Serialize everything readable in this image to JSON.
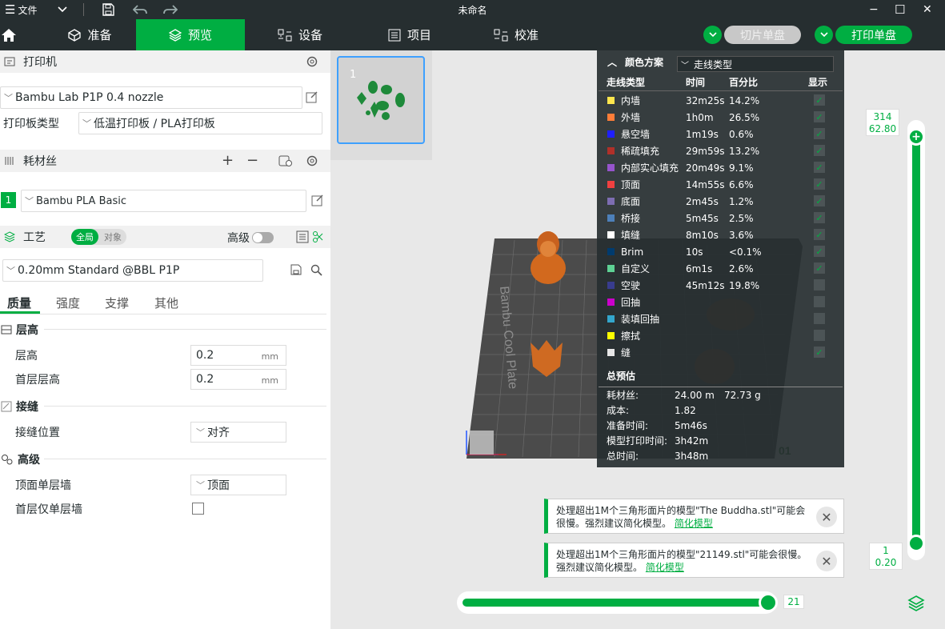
{
  "titlebar": {
    "menu_label": "文件",
    "title": "未命名",
    "min_glyph": "−",
    "max_glyph": "☐",
    "close_glyph": "✕"
  },
  "nav": {
    "tabs": [
      {
        "label": "准备",
        "icon": "cube-icon"
      },
      {
        "label": "预览",
        "icon": "layers-icon",
        "active": true
      },
      {
        "label": "设备",
        "icon": "device-icon"
      },
      {
        "label": "项目",
        "icon": "project-icon"
      },
      {
        "label": "校准",
        "icon": "calibrate-icon"
      }
    ],
    "slice_button": "切片单盘",
    "print_button": "打印单盘"
  },
  "printer": {
    "section_label": "打印机",
    "printer_value": "Bambu Lab P1P 0.4 nozzle",
    "plate_type_label": "打印板类型",
    "plate_type_value": "低温打印板 / PLA打印板"
  },
  "filament": {
    "section_label": "耗材丝",
    "slot_number": "1",
    "slot_color": "#00ae42",
    "value": "Bambu PLA Basic",
    "add_glyph": "+",
    "remove_glyph": "−"
  },
  "process": {
    "section_label": "工艺",
    "toggle_global": "全局",
    "toggle_object": "对象",
    "advanced_label": "高级",
    "preset_value": "0.20mm Standard @BBL P1P",
    "tabs": [
      "质量",
      "强度",
      "支撑",
      "其他"
    ],
    "groups": {
      "layer_height": {
        "title": "层高",
        "layer_height_label": "层高",
        "layer_height_value": "0.2",
        "layer_height_unit": "mm",
        "first_layer_label": "首层层高",
        "first_layer_value": "0.2",
        "first_layer_unit": "mm"
      },
      "seam": {
        "title": "接缝",
        "position_label": "接缝位置",
        "position_value": "对齐"
      },
      "advanced": {
        "title": "高级",
        "top_wall_label": "顶面单层墙",
        "top_wall_value": "顶面",
        "first_layer_wall_label": "首层仅单层墙"
      }
    }
  },
  "plate": {
    "thumbnail_index": "1",
    "bed_label": "Bambu Cool Plate",
    "plate_number": "01"
  },
  "legend": {
    "header": "颜色方案",
    "scheme_value": "走线类型",
    "columns": [
      "走线类型",
      "时间",
      "百分比",
      "显示"
    ],
    "rows": [
      {
        "name": "内墙",
        "time": "32m25s",
        "pct": "14.2%",
        "color": "#ffe64d",
        "shown": true
      },
      {
        "name": "外墙",
        "time": "1h0m",
        "pct": "26.5%",
        "color": "#ff7d38",
        "shown": true
      },
      {
        "name": "悬空墙",
        "time": "1m19s",
        "pct": "0.6%",
        "color": "#1f1fff",
        "shown": true
      },
      {
        "name": "稀疏填充",
        "time": "29m59s",
        "pct": "13.2%",
        "color": "#b03029",
        "shown": true
      },
      {
        "name": "内部实心填充",
        "time": "20m49s",
        "pct": "9.1%",
        "color": "#9654cc",
        "shown": true
      },
      {
        "name": "顶面",
        "time": "14m55s",
        "pct": "6.6%",
        "color": "#f04040",
        "shown": true
      },
      {
        "name": "底面",
        "time": "2m45s",
        "pct": "1.2%",
        "color": "#7d6db2",
        "shown": true
      },
      {
        "name": "桥接",
        "time": "5m45s",
        "pct": "2.5%",
        "color": "#4d80ba",
        "shown": true
      },
      {
        "name": "填缝",
        "time": "8m10s",
        "pct": "3.6%",
        "color": "#ffffff",
        "shown": true
      },
      {
        "name": "Brim",
        "time": "10s",
        "pct": "<0.1%",
        "color": "#003b6e",
        "shown": true
      },
      {
        "name": "自定义",
        "time": "6m1s",
        "pct": "2.6%",
        "color": "#5ed194",
        "shown": true
      },
      {
        "name": "空驶",
        "time": "45m12s",
        "pct": "19.8%",
        "color": "#383c8e",
        "shown": false
      },
      {
        "name": "回抽",
        "time": "",
        "pct": "",
        "color": "#cc00cc",
        "shown": false
      },
      {
        "name": "装填回抽",
        "time": "",
        "pct": "",
        "color": "#33a6cc",
        "shown": false
      },
      {
        "name": "擦拭",
        "time": "",
        "pct": "",
        "color": "#ffff00",
        "shown": false
      },
      {
        "name": "缝",
        "time": "",
        "pct": "",
        "color": "#e6e6e6",
        "shown": true
      }
    ],
    "summary": {
      "title": "总预估",
      "filament_label": "耗材丝:",
      "filament_length": "24.00 m",
      "filament_weight": "72.73 g",
      "cost_label": "成本:",
      "cost_value": "1.82",
      "prep_label": "准备时间:",
      "prep_value": "5m46s",
      "model_label": "模型打印时间:",
      "model_value": "3h42m",
      "total_label": "总时间:",
      "total_value": "3h48m"
    }
  },
  "notifications": [
    {
      "text": "处理超出1M个三角形面片的模型\"The Buddha.stl\"可能会很慢。强烈建议简化模型。",
      "link": "简化模型"
    },
    {
      "text": "处理超出1M个三角形面片的模型\"21149.stl\"可能会很慢。强烈建议简化模型。",
      "link": "简化模型"
    }
  ],
  "layer_slider": {
    "top_layer": "314",
    "top_height": "62.80",
    "bottom_layer": "1",
    "bottom_height": "0.20"
  },
  "move_slider": {
    "value": "21"
  }
}
